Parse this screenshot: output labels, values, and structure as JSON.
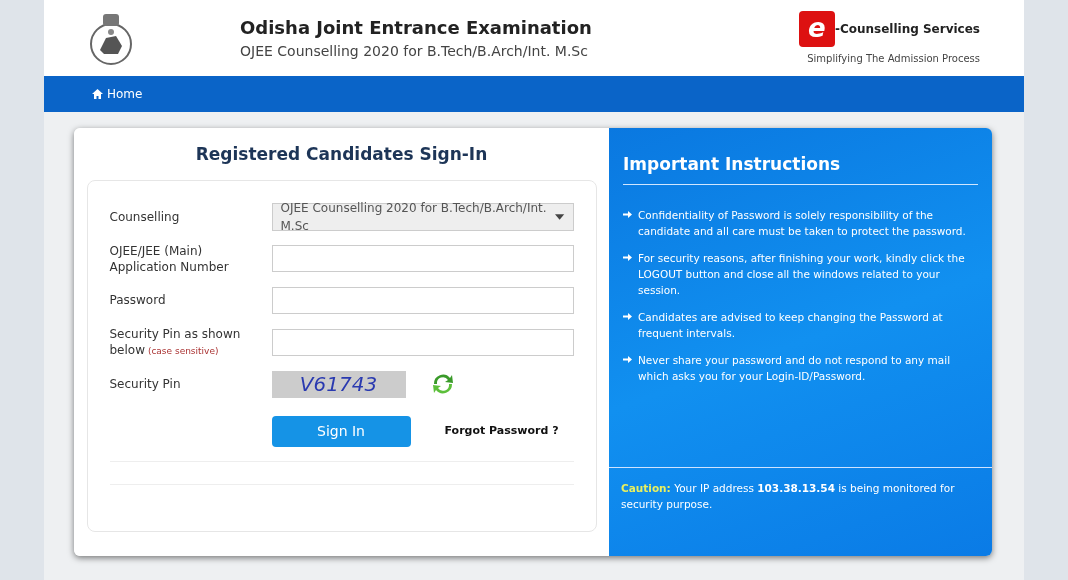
{
  "header": {
    "title": "Odisha Joint Entrance Examination",
    "subtitle": "OJEE Counselling 2020 for B.Tech/B.Arch/Int. M.Sc",
    "brand_letter": "e",
    "brand_name": "-Counselling Services",
    "brand_tagline": "Simplifying The Admission Process"
  },
  "nav": [
    {
      "label": "Home",
      "selected": false
    }
  ],
  "signin": {
    "title": "Registered Candidates Sign-In",
    "fields": [
      {
        "kind": "select",
        "label": "Counselling",
        "value": "OJEE Counselling 2020 for B.Tech/B.Arch/Int. M.Sc"
      },
      {
        "kind": "input",
        "label": "OJEE/JEE (Main) Application Number"
      },
      {
        "kind": "input",
        "label": "Password"
      },
      {
        "kind": "input",
        "label": "Security Pin as shown below",
        "note": "(case sensitive)"
      },
      {
        "kind": "captcha",
        "label": "Security Pin",
        "value": "V61743"
      }
    ],
    "submit": "Sign In",
    "forgot": "Forgot Password ?"
  },
  "instructions": {
    "title": "Important Instructions",
    "items": [
      "Confidentiality of Password is solely responsibility of the candidate and all care must be taken to protect the password.",
      "For security reasons, after finishing your work, kindly click the LOGOUT button and close all the windows related to your session.",
      "Candidates are advised to keep changing the Password at frequent intervals.",
      "Never share your password and do not respond to any mail which asks you for your Login-ID/Password."
    ],
    "caution_label": "Caution:",
    "caution_text": "Your IP address **103.38.13.54** is being monitored for security purpose."
  }
}
